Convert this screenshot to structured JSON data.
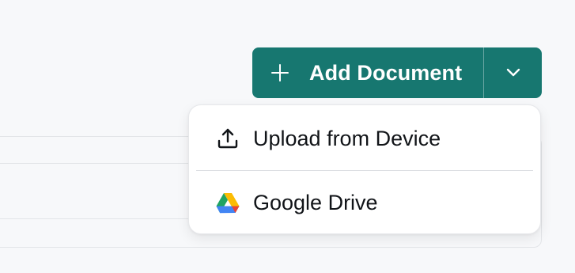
{
  "toolbar": {
    "add_document_label": "Add Document"
  },
  "menu": {
    "items": [
      {
        "label": "Upload from Device",
        "icon": "upload-icon"
      },
      {
        "label": "Google Drive",
        "icon": "google-drive-icon"
      }
    ]
  },
  "colors": {
    "accent": "#177770",
    "background": "#f7f8fa"
  }
}
